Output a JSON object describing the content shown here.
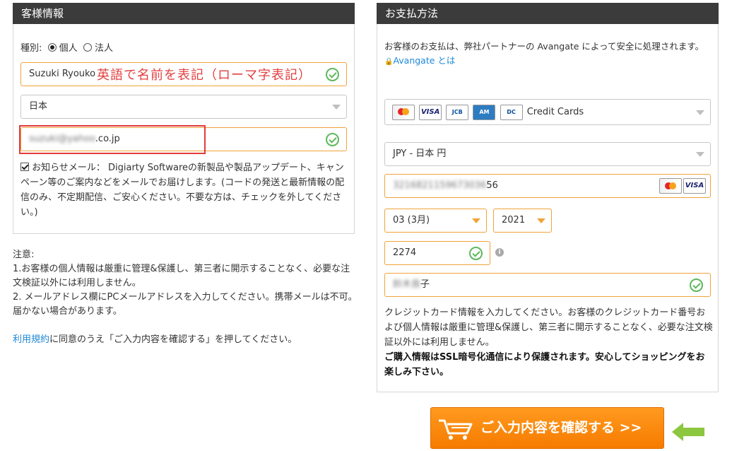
{
  "customer": {
    "header": "客様情報",
    "type_label": "種別:",
    "type_options": [
      "個人",
      "法人"
    ],
    "name_value": "Suzuki Ryouko",
    "name_annotation": "英語で名前を表記（ローマ字表記）",
    "country_value": "日本",
    "email_blurred_part": "suzuki@yahoo",
    "email_visible_part": ".co.jp",
    "newsletter_text": "お知らせメール： Digiarty Softwareの新製品や製品アップデート、キャンペーン等のご案内などをメールでお届けします。(コードの発送と最新情報の配信のみ、不定期配信、ご安心ください。不要な方は、チェックを外してください。)"
  },
  "notes": {
    "title": "注意:",
    "line1": "1.お客様の個人情報は厳重に管理&保護し、第三者に開示することなく、必要な注文検証以外には利用しません。",
    "line2": "2. メールアドレス欄にPCメールアドレスを入力してください。携帯メールは不可。届かない場合があります。",
    "terms_link": "利用規約",
    "terms_rest": "に同意のうえ「ご入力内容を確認する」を押してください。"
  },
  "payment": {
    "header": "お支払方法",
    "intro": "お客様のお支払は、弊社パートナーの Avangate によって安全に処理されます。",
    "avangate_link": "Avangate とは",
    "method_label": "Credit Cards",
    "currency_value": "JPY - 日本 円",
    "card_number_blurred": "3216821159673036",
    "card_number_visible": "56",
    "expiry_month": "03 (3月)",
    "expiry_year": "2021",
    "cvv": "2274",
    "holder_blurred": "鈴木良",
    "holder_visible": "子",
    "info_text": "クレジットカード情報を入力してください。お客様のクレジットカード番号および個人情報は厳重に管理&保護し、第三者に開示することなく、必要な注文検証以外には利用しません。",
    "ssl_text": "ご購入情報はSSL暗号化通信により保護されます。安心してショッピングをお楽しみ下さい。",
    "card_logos": [
      "mastercard-icon",
      "visa-icon",
      "jcb-icon",
      "amex-icon",
      "diners-icon"
    ]
  },
  "confirm_button": "ご入力内容を確認する >>",
  "colors": {
    "accent": "#f57b00",
    "header": "#3b3b3b",
    "link": "#1d88d8",
    "annotation": "#e34040",
    "ok": "#5cb85c"
  }
}
